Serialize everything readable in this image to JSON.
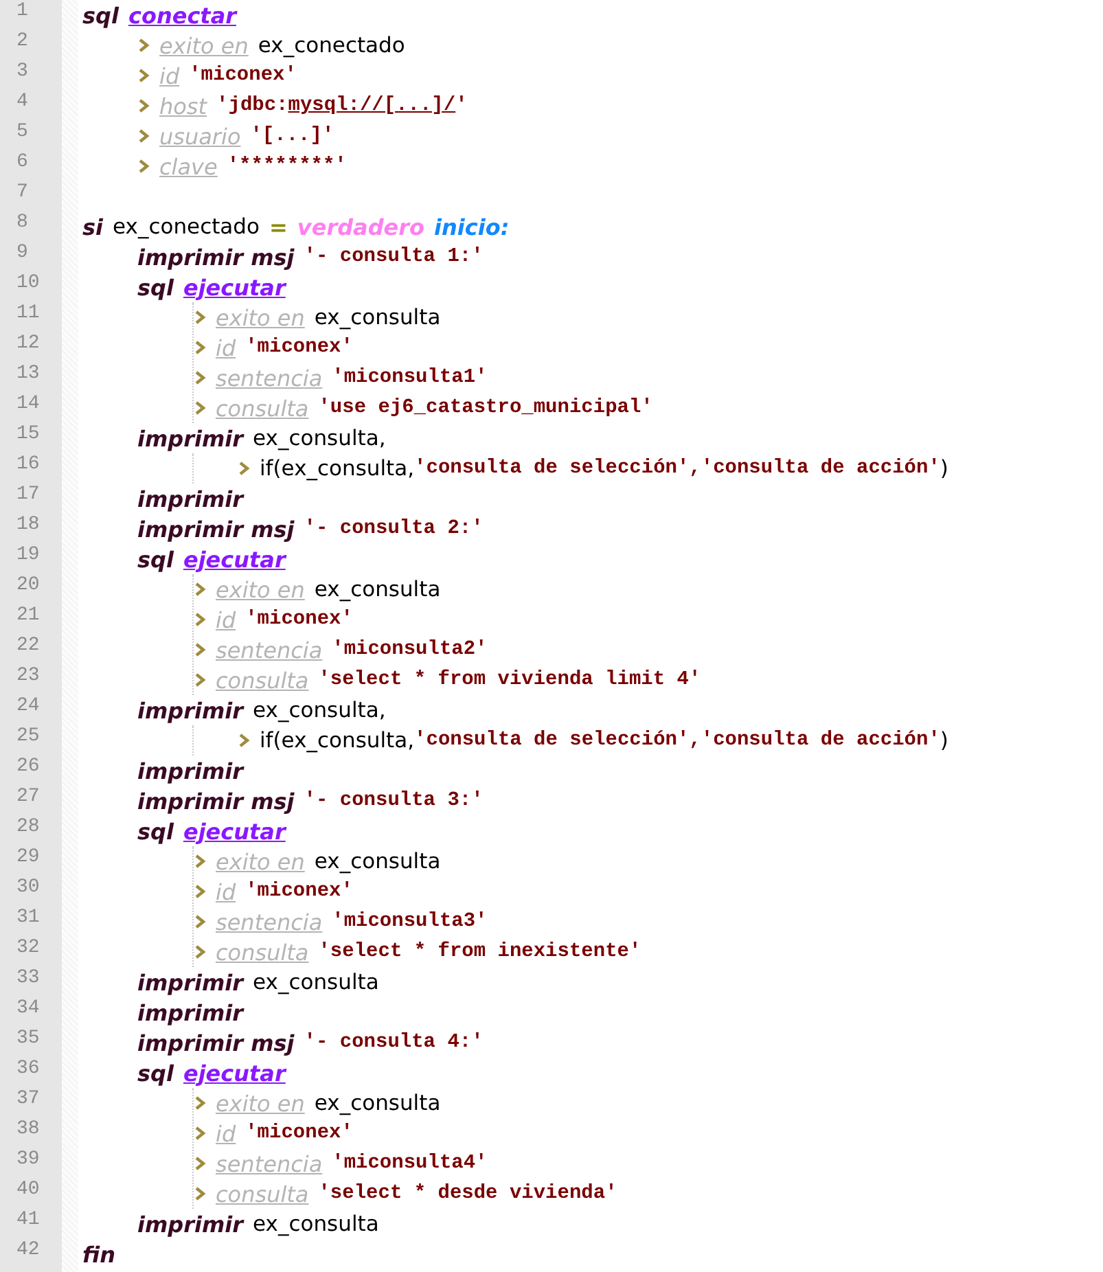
{
  "lines": [
    {
      "number": "1",
      "tokens": [
        {
          "kind": "keyword",
          "text": "sql"
        },
        {
          "kind": "command",
          "text": "conectar"
        }
      ],
      "children": [
        {
          "number": "2",
          "kind": "param",
          "tokens": [
            {
              "kind": "param",
              "text": "exito en"
            },
            {
              "kind": "plain",
              "text": "ex_conectado"
            }
          ]
        },
        {
          "number": "3",
          "kind": "param",
          "tokens": [
            {
              "kind": "param",
              "text": "id"
            },
            {
              "kind": "string",
              "text": "'miconex'"
            }
          ]
        },
        {
          "number": "4",
          "kind": "param",
          "tokens": [
            {
              "kind": "param",
              "text": "host"
            },
            {
              "kind": "string",
              "text": "'jdbc:"
            },
            {
              "kind": "link",
              "text": "mysql://[...]/"
            },
            {
              "kind": "string",
              "text": "'"
            }
          ]
        },
        {
          "number": "5",
          "kind": "param",
          "tokens": [
            {
              "kind": "param",
              "text": "usuario"
            },
            {
              "kind": "string",
              "text": "'[...]'"
            }
          ]
        },
        {
          "number": "6",
          "kind": "param",
          "tokens": [
            {
              "kind": "param",
              "text": "clave"
            },
            {
              "kind": "string",
              "text": "'********'"
            }
          ]
        }
      ]
    },
    {
      "number": "7"
    },
    {
      "number": "8",
      "tokens": [
        {
          "kind": "keyword",
          "text": "si"
        },
        {
          "kind": "plain",
          "text": "ex_conectado"
        },
        {
          "kind": "operator",
          "text": "="
        },
        {
          "kind": "boolean",
          "text": "verdadero"
        },
        {
          "kind": "block",
          "text": "inicio:"
        }
      ],
      "children": [
        {
          "number": "9",
          "tokens": [
            {
              "kind": "keyword",
              "text": "imprimir msj"
            },
            {
              "kind": "string",
              "text": "'- consulta 1:'"
            }
          ]
        },
        {
          "number": "10",
          "tokens": [
            {
              "kind": "keyword",
              "text": "sql"
            },
            {
              "kind": "command",
              "text": "ejecutar"
            }
          ],
          "children": [
            {
              "number": "11",
              "kind": "param",
              "tokens": [
                {
                  "kind": "param",
                  "text": "exito en"
                },
                {
                  "kind": "plain",
                  "text": "ex_consulta"
                }
              ]
            },
            {
              "number": "12",
              "kind": "param",
              "tokens": [
                {
                  "kind": "param",
                  "text": "id"
                },
                {
                  "kind": "string",
                  "text": "'miconex'"
                }
              ]
            },
            {
              "number": "13",
              "kind": "param",
              "tokens": [
                {
                  "kind": "param",
                  "text": "sentencia"
                },
                {
                  "kind": "string",
                  "text": "'miconsulta1'"
                }
              ]
            },
            {
              "number": "14",
              "kind": "param",
              "tokens": [
                {
                  "kind": "param",
                  "text": "consulta"
                },
                {
                  "kind": "string",
                  "text": "'use ej6_catastro_municipal'"
                }
              ]
            }
          ]
        },
        {
          "number": "15",
          "tokens": [
            {
              "kind": "keyword",
              "text": "imprimir"
            },
            {
              "kind": "plain",
              "text": "ex_consulta,"
            }
          ],
          "children": [
            {
              "number": "16",
              "kind": "continuation",
              "tokens": [
                {
                  "kind": "plain",
                  "text": "if(ex_consulta,"
                },
                {
                  "kind": "string",
                  "text": "'consulta de selección','consulta de acción'"
                },
                {
                  "kind": "plain",
                  "text": ")"
                }
              ]
            }
          ]
        },
        {
          "number": "17",
          "tokens": [
            {
              "kind": "keyword",
              "text": "imprimir"
            }
          ]
        },
        {
          "number": "18",
          "tokens": [
            {
              "kind": "keyword",
              "text": "imprimir msj"
            },
            {
              "kind": "string",
              "text": "'- consulta 2:'"
            }
          ]
        },
        {
          "number": "19",
          "tokens": [
            {
              "kind": "keyword",
              "text": "sql"
            },
            {
              "kind": "command",
              "text": "ejecutar"
            }
          ],
          "children": [
            {
              "number": "20",
              "kind": "param",
              "tokens": [
                {
                  "kind": "param",
                  "text": "exito en"
                },
                {
                  "kind": "plain",
                  "text": "ex_consulta"
                }
              ]
            },
            {
              "number": "21",
              "kind": "param",
              "tokens": [
                {
                  "kind": "param",
                  "text": "id"
                },
                {
                  "kind": "string",
                  "text": "'miconex'"
                }
              ]
            },
            {
              "number": "22",
              "kind": "param",
              "tokens": [
                {
                  "kind": "param",
                  "text": "sentencia"
                },
                {
                  "kind": "string",
                  "text": "'miconsulta2'"
                }
              ]
            },
            {
              "number": "23",
              "kind": "param",
              "tokens": [
                {
                  "kind": "param",
                  "text": "consulta"
                },
                {
                  "kind": "string",
                  "text": "'select * from vivienda limit 4'"
                }
              ]
            }
          ]
        },
        {
          "number": "24",
          "tokens": [
            {
              "kind": "keyword",
              "text": "imprimir"
            },
            {
              "kind": "plain",
              "text": "ex_consulta,"
            }
          ],
          "children": [
            {
              "number": "25",
              "kind": "continuation",
              "tokens": [
                {
                  "kind": "plain",
                  "text": "if(ex_consulta,"
                },
                {
                  "kind": "string",
                  "text": "'consulta de selección','consulta de acción'"
                },
                {
                  "kind": "plain",
                  "text": ")"
                }
              ]
            }
          ]
        },
        {
          "number": "26",
          "tokens": [
            {
              "kind": "keyword",
              "text": "imprimir"
            }
          ]
        },
        {
          "number": "27",
          "tokens": [
            {
              "kind": "keyword",
              "text": "imprimir msj"
            },
            {
              "kind": "string",
              "text": "'- consulta 3:'"
            }
          ]
        },
        {
          "number": "28",
          "tokens": [
            {
              "kind": "keyword",
              "text": "sql"
            },
            {
              "kind": "command",
              "text": "ejecutar"
            }
          ],
          "children": [
            {
              "number": "29",
              "kind": "param",
              "tokens": [
                {
                  "kind": "param",
                  "text": "exito en"
                },
                {
                  "kind": "plain",
                  "text": "ex_consulta"
                }
              ]
            },
            {
              "number": "30",
              "kind": "param",
              "tokens": [
                {
                  "kind": "param",
                  "text": "id"
                },
                {
                  "kind": "string",
                  "text": "'miconex'"
                }
              ]
            },
            {
              "number": "31",
              "kind": "param",
              "tokens": [
                {
                  "kind": "param",
                  "text": "sentencia"
                },
                {
                  "kind": "string",
                  "text": "'miconsulta3'"
                }
              ]
            },
            {
              "number": "32",
              "kind": "param",
              "tokens": [
                {
                  "kind": "param",
                  "text": "consulta"
                },
                {
                  "kind": "string",
                  "text": "'select * from inexistente'"
                }
              ]
            }
          ]
        },
        {
          "number": "33",
          "tokens": [
            {
              "kind": "keyword",
              "text": "imprimir"
            },
            {
              "kind": "plain",
              "text": "ex_consulta"
            }
          ]
        },
        {
          "number": "34",
          "tokens": [
            {
              "kind": "keyword",
              "text": "imprimir"
            }
          ]
        },
        {
          "number": "35",
          "tokens": [
            {
              "kind": "keyword",
              "text": "imprimir msj"
            },
            {
              "kind": "string",
              "text": "'- consulta 4:'"
            }
          ]
        },
        {
          "number": "36",
          "tokens": [
            {
              "kind": "keyword",
              "text": "sql"
            },
            {
              "kind": "command",
              "text": "ejecutar"
            }
          ],
          "children": [
            {
              "number": "37",
              "kind": "param",
              "tokens": [
                {
                  "kind": "param",
                  "text": "exito en"
                },
                {
                  "kind": "plain",
                  "text": "ex_consulta"
                }
              ]
            },
            {
              "number": "38",
              "kind": "param",
              "tokens": [
                {
                  "kind": "param",
                  "text": "id"
                },
                {
                  "kind": "string",
                  "text": "'miconex'"
                }
              ]
            },
            {
              "number": "39",
              "kind": "param",
              "tokens": [
                {
                  "kind": "param",
                  "text": "sentencia"
                },
                {
                  "kind": "string",
                  "text": "'miconsulta4'"
                }
              ]
            },
            {
              "number": "40",
              "kind": "param",
              "tokens": [
                {
                  "kind": "param",
                  "text": "consulta"
                },
                {
                  "kind": "string",
                  "text": "'select * desde vivienda'"
                }
              ]
            }
          ]
        },
        {
          "number": "41",
          "tokens": [
            {
              "kind": "keyword",
              "text": "imprimir"
            },
            {
              "kind": "plain",
              "text": "ex_consulta"
            }
          ]
        }
      ]
    },
    {
      "number": "42",
      "tokens": [
        {
          "kind": "keyword",
          "text": "fin"
        }
      ]
    }
  ]
}
